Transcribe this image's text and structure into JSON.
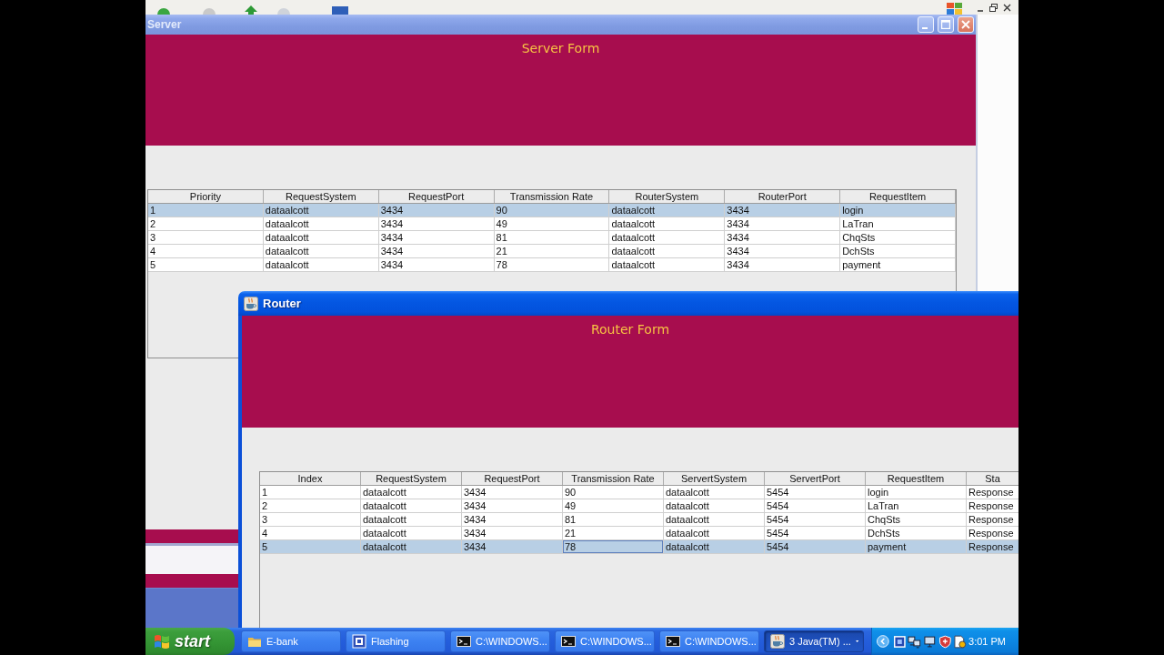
{
  "server_window": {
    "title": "Server",
    "active": false,
    "heading": "Server Form",
    "table": {
      "columns": [
        "Priority",
        "RequestSystem",
        "RequestPort",
        "Transmission Rate",
        "RouterSystem",
        "RouterPort",
        "RequestItem"
      ],
      "rows": [
        {
          "selected": true,
          "cells": [
            "1",
            "dataalcott",
            "3434",
            "90",
            "dataalcott",
            "3434",
            "login"
          ]
        },
        {
          "selected": false,
          "cells": [
            "2",
            "dataalcott",
            "3434",
            "49",
            "dataalcott",
            "3434",
            "LaTran"
          ]
        },
        {
          "selected": false,
          "cells": [
            "3",
            "dataalcott",
            "3434",
            "81",
            "dataalcott",
            "3434",
            "ChqSts"
          ]
        },
        {
          "selected": false,
          "cells": [
            "4",
            "dataalcott",
            "3434",
            "21",
            "dataalcott",
            "3434",
            "DchSts"
          ]
        },
        {
          "selected": false,
          "cells": [
            "5",
            "dataalcott",
            "3434",
            "78",
            "dataalcott",
            "3434",
            "payment"
          ]
        }
      ]
    }
  },
  "router_window": {
    "title": "Router",
    "active": true,
    "heading": "Router Form",
    "table": {
      "columns": [
        "Index",
        "RequestSystem",
        "RequestPort",
        "Transmission Rate",
        "ServertSystem",
        "ServertPort",
        "RequestItem",
        "Sta"
      ],
      "rows": [
        {
          "selected": false,
          "cells": [
            {
              "text": "1",
              "focused": false
            },
            {
              "text": "dataalcott",
              "focused": false
            },
            {
              "text": "3434",
              "focused": false
            },
            {
              "text": "90",
              "focused": false
            },
            {
              "text": "dataalcott",
              "focused": false
            },
            {
              "text": "5454",
              "focused": false
            },
            {
              "text": "login",
              "focused": false
            },
            {
              "text": "Response",
              "focused": false
            }
          ]
        },
        {
          "selected": false,
          "cells": [
            {
              "text": "2",
              "focused": false
            },
            {
              "text": "dataalcott",
              "focused": false
            },
            {
              "text": "3434",
              "focused": false
            },
            {
              "text": "49",
              "focused": false
            },
            {
              "text": "dataalcott",
              "focused": false
            },
            {
              "text": "5454",
              "focused": false
            },
            {
              "text": "LaTran",
              "focused": false
            },
            {
              "text": "Response",
              "focused": false
            }
          ]
        },
        {
          "selected": false,
          "cells": [
            {
              "text": "3",
              "focused": false
            },
            {
              "text": "dataalcott",
              "focused": false
            },
            {
              "text": "3434",
              "focused": false
            },
            {
              "text": "81",
              "focused": false
            },
            {
              "text": "dataalcott",
              "focused": false
            },
            {
              "text": "5454",
              "focused": false
            },
            {
              "text": "ChqSts",
              "focused": false
            },
            {
              "text": "Response",
              "focused": false
            }
          ]
        },
        {
          "selected": false,
          "cells": [
            {
              "text": "4",
              "focused": false
            },
            {
              "text": "dataalcott",
              "focused": false
            },
            {
              "text": "3434",
              "focused": false
            },
            {
              "text": "21",
              "focused": false
            },
            {
              "text": "dataalcott",
              "focused": false
            },
            {
              "text": "5454",
              "focused": false
            },
            {
              "text": "DchSts",
              "focused": false
            },
            {
              "text": "Response",
              "focused": false
            }
          ]
        },
        {
          "selected": true,
          "cells": [
            {
              "text": "5",
              "focused": false
            },
            {
              "text": "dataalcott",
              "focused": false
            },
            {
              "text": "3434",
              "focused": false
            },
            {
              "text": "78",
              "focused": true
            },
            {
              "text": "dataalcott",
              "focused": false
            },
            {
              "text": "5454",
              "focused": false
            },
            {
              "text": "payment",
              "focused": false
            },
            {
              "text": "Response",
              "focused": false
            }
          ]
        }
      ]
    }
  },
  "taskbar": {
    "start": "start",
    "buttons": [
      {
        "label": "E-bank",
        "kind": "folder",
        "selected": false,
        "grouped": false
      },
      {
        "label": "Flashing",
        "kind": "app",
        "selected": false,
        "grouped": false
      },
      {
        "label": "C:\\WINDOWS...",
        "kind": "console",
        "selected": false,
        "grouped": false
      },
      {
        "label": "C:\\WINDOWS...",
        "kind": "console",
        "selected": false,
        "grouped": false
      },
      {
        "label": "C:\\WINDOWS...",
        "kind": "console",
        "selected": false,
        "grouped": false
      },
      {
        "label": "3 Java(TM) ...",
        "kind": "java",
        "selected": true,
        "grouped": true
      }
    ],
    "clock": "3:01 PM"
  }
}
